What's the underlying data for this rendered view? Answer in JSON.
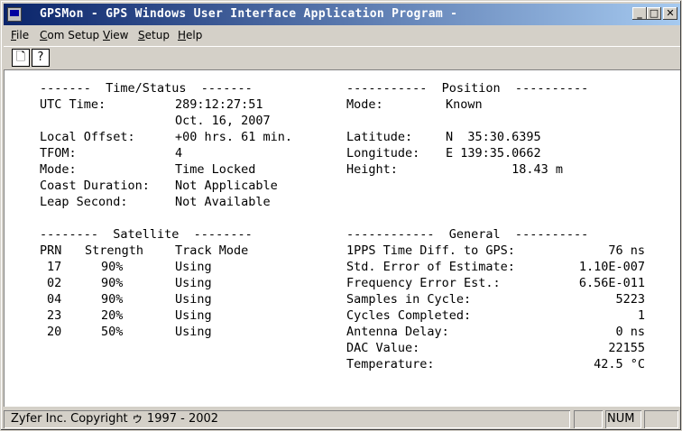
{
  "window": {
    "title": "GPSMon - GPS Windows User Interface Application Program -"
  },
  "menu": {
    "file": {
      "first": "F",
      "rest": "ile"
    },
    "com_setup": {
      "first": "C",
      "rest": "om Setup"
    },
    "view": {
      "first": "V",
      "rest": "iew"
    },
    "setup": {
      "first": "S",
      "rest": "etup"
    },
    "help": {
      "first": "H",
      "rest": "elp"
    }
  },
  "toolbar": {
    "new_glyph": "🗋",
    "help_glyph": "?"
  },
  "time_status": {
    "header": "-------  Time/Status  -------",
    "utc_label": "UTC Time:",
    "utc_value": "289:12:27:51",
    "date_value": "Oct. 16, 2007",
    "offset_label": "Local Offset:",
    "offset_value": "+00 hrs. 61 min.",
    "tfom_label": "TFOM:",
    "tfom_value": "4",
    "mode_label": "Mode:",
    "mode_value": "Time Locked",
    "coast_label": "Coast Duration:",
    "coast_value": "Not Applicable",
    "leap_label": "Leap Second:",
    "leap_value": "Not Available"
  },
  "position": {
    "header": "-----------  Position  ----------",
    "mode_label": "Mode:",
    "mode_value": "Known",
    "lat_label": "Latitude:",
    "lat_value": "N  35:30.6395",
    "lon_label": "Longitude:",
    "lon_value": "E 139:35.0662",
    "height_label": "Height:",
    "height_value": "18.43 m"
  },
  "satellite": {
    "header": "--------  Satellite  --------",
    "col_prn": "PRN",
    "col_strength": "Strength",
    "col_track": "Track Mode",
    "rows": [
      {
        "prn": "17",
        "strength": "90%",
        "mode": "Using"
      },
      {
        "prn": "02",
        "strength": "90%",
        "mode": "Using"
      },
      {
        "prn": "04",
        "strength": "90%",
        "mode": "Using"
      },
      {
        "prn": "23",
        "strength": "20%",
        "mode": "Using"
      },
      {
        "prn": "20",
        "strength": "50%",
        "mode": "Using"
      }
    ]
  },
  "general": {
    "header": "------------  General  ----------",
    "rows": [
      {
        "label": "1PPS Time Diff. to GPS:",
        "value": "76 ns"
      },
      {
        "label": "Std. Error of Estimate:",
        "value": "1.10E-007"
      },
      {
        "label": "Frequency Error Est.:",
        "value": "6.56E-011"
      },
      {
        "label": "Samples in Cycle:",
        "value": "5223"
      },
      {
        "label": "Cycles Completed:",
        "value": "1"
      },
      {
        "label": "Antenna Delay:",
        "value": "0 ns"
      },
      {
        "label": "DAC Value:",
        "value": "22155"
      },
      {
        "label": "Temperature:",
        "value": "42.5 °C"
      }
    ]
  },
  "statusbar": {
    "copyright": "Zyfer Inc. Copyright ゥ 1997 - 2002",
    "num": "NUM"
  }
}
